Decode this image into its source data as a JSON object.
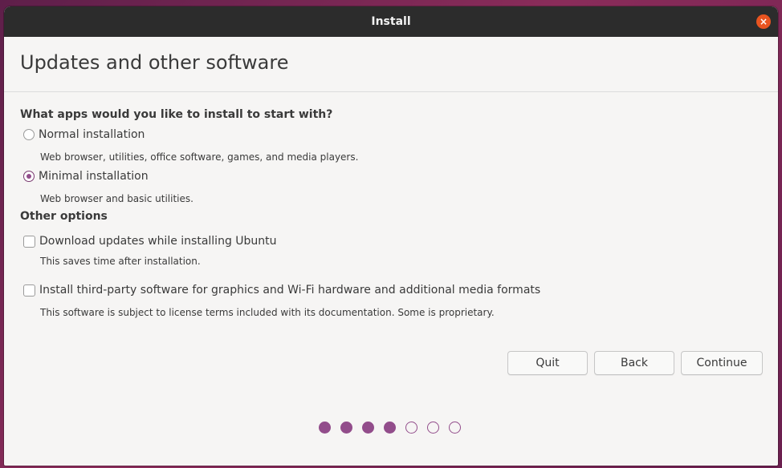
{
  "window": {
    "title": "Install",
    "close_label": "×"
  },
  "page": {
    "title": "Updates and other software"
  },
  "question": "What apps would you like to install to start with?",
  "install_options": [
    {
      "label": "Normal installation",
      "description": "Web browser, utilities, office software, games, and media players.",
      "selected": false
    },
    {
      "label": "Minimal installation",
      "description": "Web browser and basic utilities.",
      "selected": true
    }
  ],
  "other_options": {
    "title": "Other options",
    "items": [
      {
        "label": "Download updates while installing Ubuntu",
        "description": "This saves time after installation.",
        "checked": false
      },
      {
        "label": "Install third-party software for graphics and Wi-Fi hardware and additional media formats",
        "description": "This software is subject to license terms included with its documentation. Some is proprietary.",
        "checked": false
      }
    ]
  },
  "buttons": {
    "quit": "Quit",
    "back": "Back",
    "continue": "Continue"
  },
  "progress": {
    "total_steps": 7,
    "completed_steps": 4
  },
  "colors": {
    "accent": "#924d8b",
    "close": "#e95420",
    "titlebar": "#2c2c2c"
  }
}
